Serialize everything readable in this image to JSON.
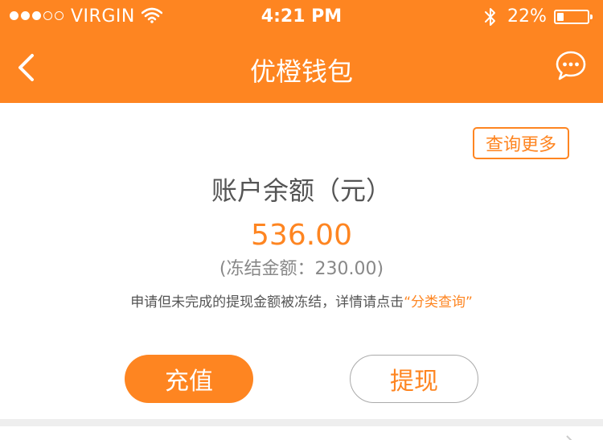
{
  "status_bar": {
    "signal_filled": 3,
    "signal_total": 5,
    "carrier": "VIRGIN",
    "time": "4:21 PM",
    "battery_percent": "22%",
    "battery_level": 0.22
  },
  "nav": {
    "title": "优橙钱包",
    "back_icon": "chevron-left-icon",
    "chat_icon": "chat-bubble-icon"
  },
  "wallet": {
    "more_label": "查询更多",
    "balance_title": "账户余额（元）",
    "balance_amount": "536.00",
    "frozen_text": "(冻结金额：230.00)",
    "note_prefix": "申请但未完成的提现金额被冻结，详情请点击",
    "note_link": "“分类查询”"
  },
  "actions": {
    "recharge_label": "充值",
    "withdraw_label": "提现"
  },
  "colors": {
    "accent": "#fe8521",
    "background": "#ffffff",
    "divider": "#eeeeee"
  }
}
